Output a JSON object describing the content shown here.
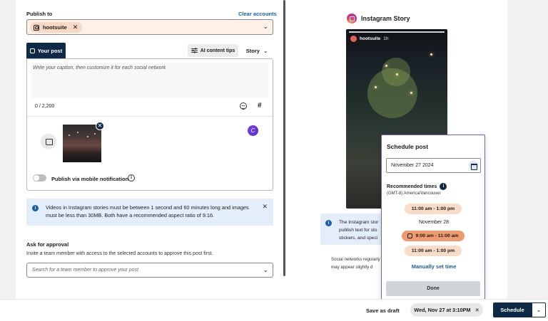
{
  "composer": {
    "publish_to_label": "Publish to",
    "clear_accounts_label": "Clear accounts",
    "account_chip_label": "hootsuite",
    "account_chip_remove": "✕",
    "chevron": "⌄",
    "tab_your_post": "Your post",
    "ai_content_tips_label": "AI content tips",
    "post_type_label": "Story",
    "caption_placeholder": "Write your caption, then customize it for each social network",
    "char_count": "0 / 2,200",
    "hashtag_glyph": "#",
    "canva_glyph": "C",
    "thumb_remove_glyph": "✕",
    "mobile_notification_label": "Publish via mobile notification",
    "info_glyph": "i"
  },
  "notice": {
    "text": "Videos in Instagram stories must be between 1 second and 60 minutes long and images must be less than 30MB. Both have a recommended aspect ratio of 9:16.",
    "close": "✕"
  },
  "approval": {
    "title": "Ask for approval",
    "description": "Invite a team member with access to the selected accounts to approve this post first.",
    "placeholder": "Search for a team member to approve your post"
  },
  "preview": {
    "header": "Instagram Story",
    "story_username": "hootsuite",
    "story_time": "1h",
    "ig_notice_lines": [
      "The Instagram stor",
      "publish text for sto",
      "stickers, and speci"
    ],
    "social_note_lines": [
      "Social networks regularly",
      "may appear slightly d"
    ]
  },
  "schedule_popover": {
    "title": "Schedule post",
    "date_value": "November 27 2024",
    "recommended_label": "Recommended times",
    "timezone": "(GMT-8) America/Vancouver",
    "slots": [
      {
        "label": "11:00 am - 1:00 pm",
        "selected": false
      },
      {
        "label": "9:00 am - 11:00 am",
        "selected": true
      },
      {
        "label": "11:00 am - 1:00 pm",
        "selected": false
      }
    ],
    "day_label": "November 28",
    "manual_label": "Manually set time",
    "done_label": "Done"
  },
  "footer": {
    "save_draft_label": "Save as draft",
    "scheduled_chip_label": "Wed, Nov 27 at 3:10PM",
    "chip_remove": "✕",
    "schedule_label": "Schedule",
    "schedule_menu_glyph": "⌄"
  },
  "colors": {
    "brand_navy": "#0e2a47",
    "link_blue": "#1a5da8",
    "account_bg": "#fdf0e6",
    "slot_peach": "#f8dcc8",
    "slot_selected": "#ef9a6e",
    "popover_border": "#7b5fb8",
    "notice_bg": "#e4eefa"
  },
  "icons": {
    "account": "instagram-icon",
    "ai": "sliders-icon",
    "emoji": "emoji-icon",
    "hashtag": "hashtag-icon",
    "media": "image-icon",
    "canva": "canva-icon",
    "info": "info-icon",
    "calendar": "calendar-icon"
  }
}
